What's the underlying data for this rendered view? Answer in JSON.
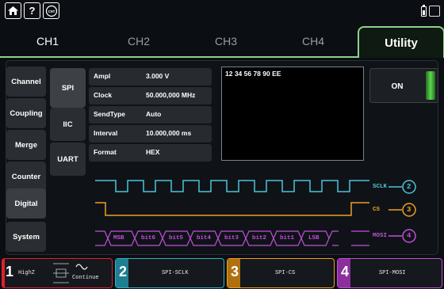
{
  "topbar": {
    "icons": [
      "home-icon",
      "help-icon",
      "cnt-icon",
      "battery-icon",
      "usb-icon"
    ],
    "help_label": "?",
    "cnt_label": "CNT"
  },
  "tabs": [
    "CH1",
    "CH2",
    "CH3",
    "CH4",
    "Utility"
  ],
  "left_menu": [
    "Channel",
    "Coupling",
    "Merge",
    "Counter",
    "Digital",
    "System"
  ],
  "protocols": [
    "SPI",
    "IIC",
    "UART"
  ],
  "params": [
    {
      "key": "Ampl",
      "value": "3.000 V"
    },
    {
      "key": "Clock",
      "value": "50.000,000 MHz"
    },
    {
      "key": "SendType",
      "value": "Auto"
    },
    {
      "key": "Interval",
      "value": "10.000,000 ms"
    },
    {
      "key": "Format",
      "value": "HEX"
    }
  ],
  "data_text": "12 34 56 78 90 EE",
  "output_button": "ON",
  "signals": {
    "sclk": {
      "label": "SCLK",
      "num": "2",
      "color": "#4fc3d8"
    },
    "cs": {
      "label": "CS",
      "num": "3",
      "color": "#f0a020"
    },
    "mosi": {
      "label": "MOSI",
      "num": "4",
      "color": "#c24fd8"
    }
  },
  "mosi_bits": [
    "MSB",
    "bit6",
    "bit5",
    "bit4",
    "bit3",
    "bit2",
    "bit1",
    "LSB"
  ],
  "channels": [
    {
      "num": "1",
      "text": "HighZ",
      "extra": "Continue",
      "color": "#e0202e"
    },
    {
      "num": "2",
      "text": "SPI-SCLK",
      "color": "#2fb3c8"
    },
    {
      "num": "3",
      "text": "SPI-CS",
      "color": "#f0a020"
    },
    {
      "num": "4",
      "text": "SPI-MOSI",
      "color": "#c24fd8"
    }
  ]
}
